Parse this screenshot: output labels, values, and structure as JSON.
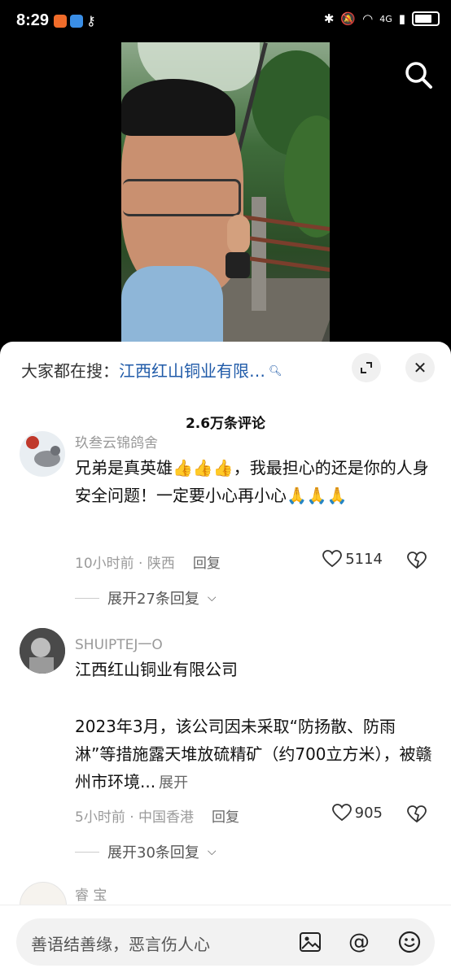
{
  "status_bar": {
    "time": "8:29",
    "network": "4G"
  },
  "hot_search": {
    "prefix": "大家都在搜：",
    "query": "江西红山铜业有限…"
  },
  "comments_count": "2.6万条评论",
  "comments": [
    {
      "username": "玖叁云锦鸽舍",
      "text": "兄弟是真英雄👍👍👍，我最担心的还是你的人身安全问题！一定要小心再小心🙏🙏🙏",
      "time_location": "10小时前 · 陕西",
      "reply_label": "回复",
      "likes": "5114",
      "expand_label": "展开27条回复"
    },
    {
      "username": "SHUIPTEJ一O",
      "text_line1": "江西红山铜业有限公司",
      "text_line2": "2023年3月，该公司因未采取“防扬散、防雨淋”等措施露天堆放硫精矿（约700立方米），被赣州市环境...",
      "more_label": "展开",
      "time_location": "5小时前 · 中国香港",
      "reply_label": "回复",
      "likes": "905",
      "expand_label": "展开30条回复"
    },
    {
      "username": "睿 宝"
    }
  ],
  "input": {
    "placeholder": "善语结善缘，恶言伤人心"
  }
}
